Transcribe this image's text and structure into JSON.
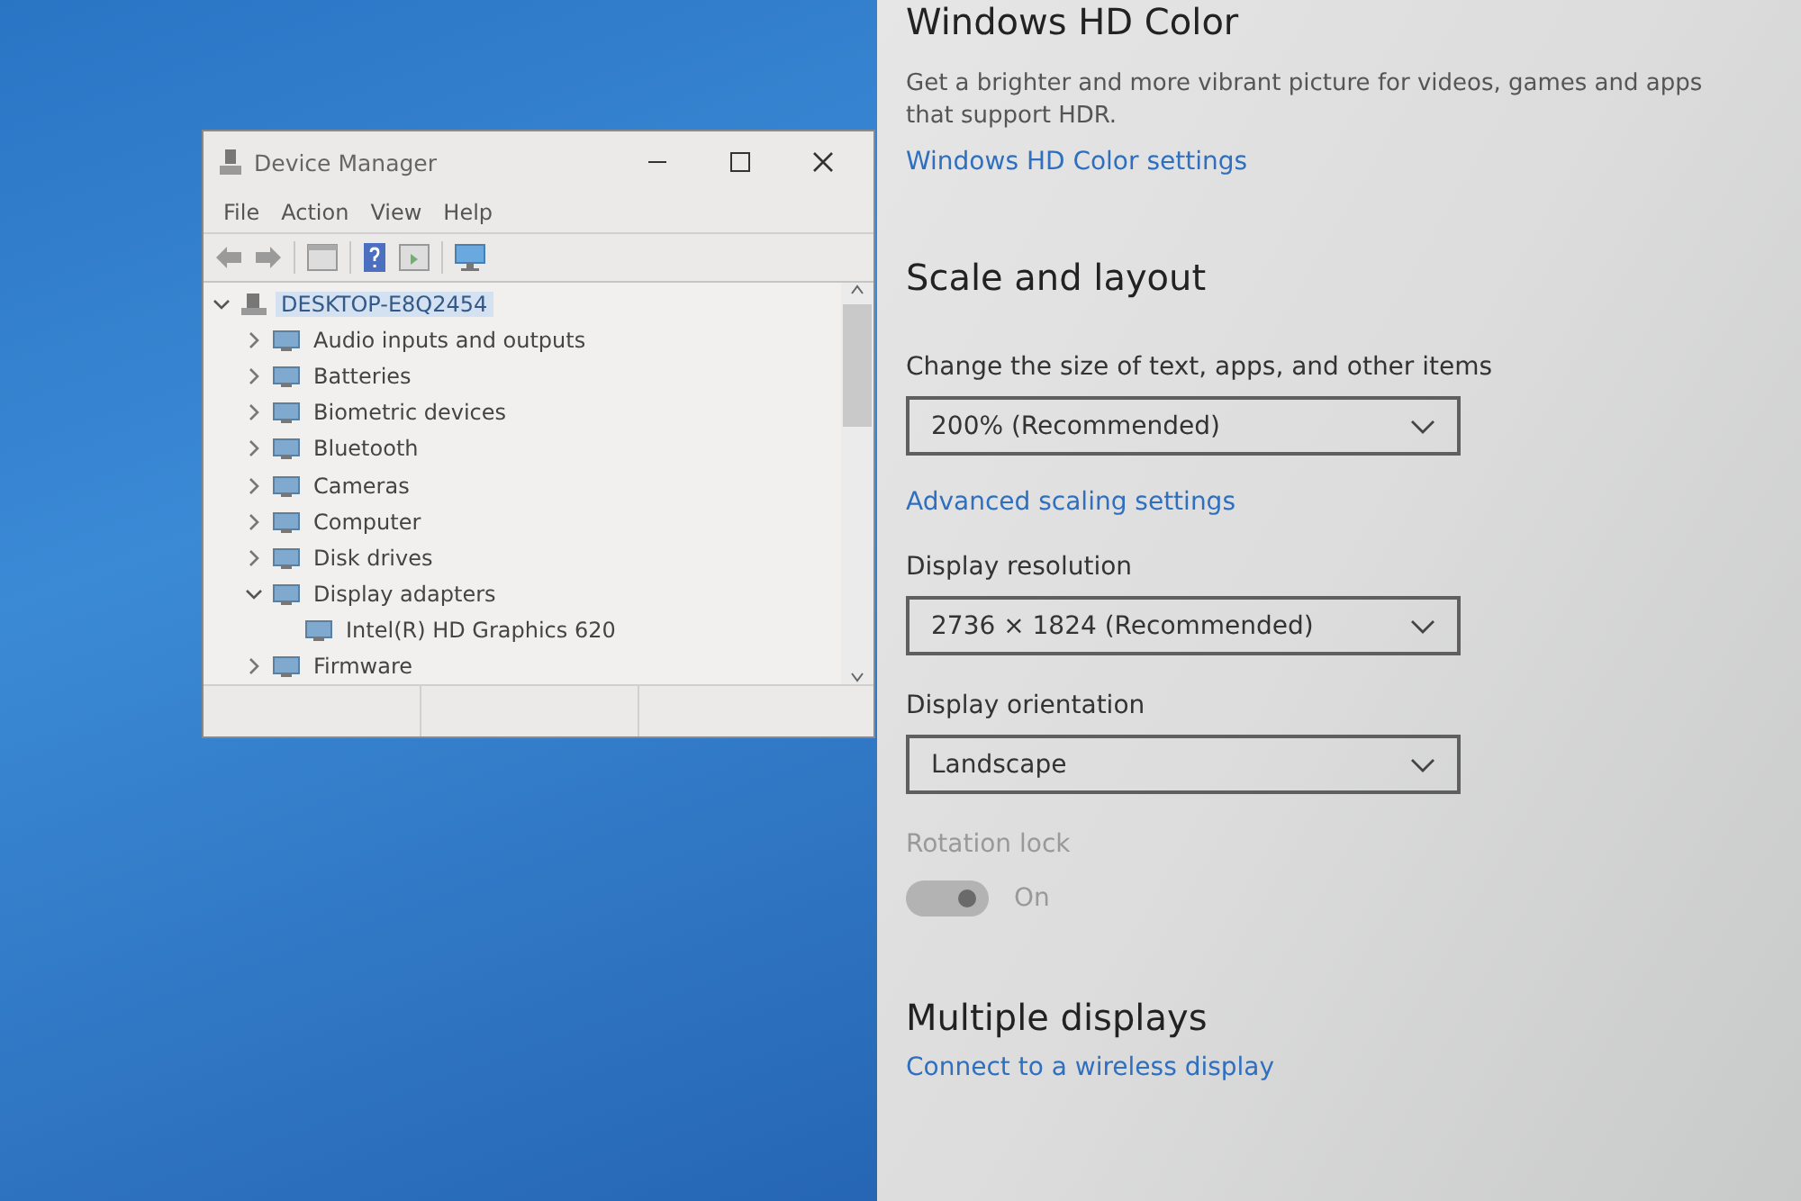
{
  "device_manager": {
    "title": "Device Manager",
    "menu": [
      "File",
      "Action",
      "View",
      "Help"
    ],
    "tree": [
      {
        "label": "DESKTOP-E8Q2454",
        "expanded": true,
        "selected": true,
        "children": [
          {
            "label": "Audio inputs and outputs",
            "expanded": false,
            "selected": false
          },
          {
            "label": "Batteries",
            "expanded": false,
            "selected": false
          },
          {
            "label": "Biometric devices",
            "expanded": false,
            "selected": false
          },
          {
            "label": "Bluetooth",
            "expanded": false,
            "selected": false
          },
          {
            "label": "Cameras",
            "expanded": false,
            "selected": false
          },
          {
            "label": "Computer",
            "expanded": false,
            "selected": false
          },
          {
            "label": "Disk drives",
            "expanded": false,
            "selected": false
          },
          {
            "label": "Display adapters",
            "expanded": true,
            "selected": false,
            "children": [
              {
                "label": "Intel(R) HD Graphics 620",
                "selected": false
              }
            ]
          },
          {
            "label": "Firmware",
            "expanded": false,
            "selected": false
          }
        ]
      }
    ]
  },
  "settings": {
    "sections": [
      {
        "heading": "Windows HD Color",
        "items": [
          {
            "kind": "text",
            "text": "Get a brighter and more vibrant picture for videos, games and apps that support HDR."
          },
          {
            "kind": "link",
            "text": "Windows HD Color settings"
          }
        ]
      },
      {
        "heading": "Scale and layout",
        "items": [
          {
            "kind": "dropdown",
            "label": "Change the size of text, apps, and other items",
            "value": "200% (Recommended)"
          },
          {
            "kind": "link",
            "text": "Advanced scaling settings"
          },
          {
            "kind": "dropdown",
            "label": "Display resolution",
            "value": "2736 × 1824 (Recommended)"
          },
          {
            "kind": "dropdown",
            "label": "Display orientation",
            "value": "Landscape"
          },
          {
            "kind": "toggle",
            "label": "Rotation lock",
            "on": true,
            "disabled": true,
            "state_text": "On"
          }
        ]
      },
      {
        "heading": "Multiple displays",
        "items": [
          {
            "kind": "link",
            "text": "Connect to a wireless display"
          }
        ]
      }
    ]
  }
}
